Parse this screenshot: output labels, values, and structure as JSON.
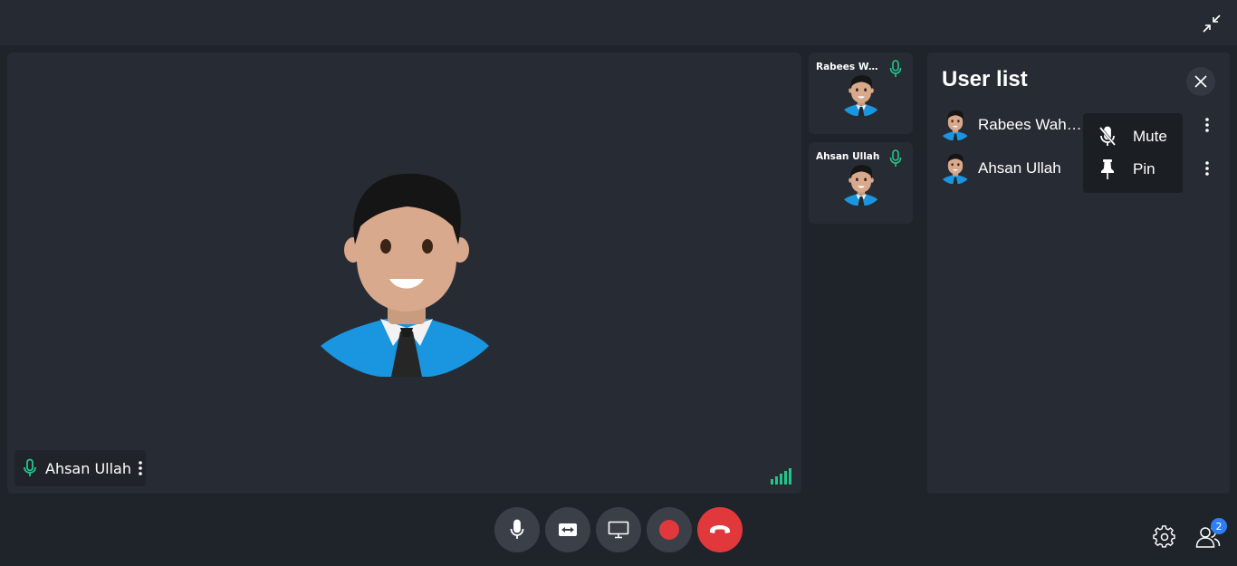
{
  "colors": {
    "accent_green": "#22c58b",
    "end_call_red": "#e0383b",
    "badge_blue": "#2d7ff2"
  },
  "main_video": {
    "participant_name": "Ahsan Ullah",
    "mic_status": "unmuted",
    "signal_strength": 5
  },
  "thumbnails": [
    {
      "name": "Rabees Waheed",
      "mic_status": "unmuted"
    },
    {
      "name": "Ahsan Ullah",
      "mic_status": "unmuted"
    }
  ],
  "user_list": {
    "title": "User list",
    "users": [
      {
        "name": "Rabees Waheed"
      },
      {
        "name": "Ahsan Ullah"
      }
    ],
    "context_menu": {
      "items": [
        {
          "label": "Mute",
          "icon": "mic-off-icon"
        },
        {
          "label": "Pin",
          "icon": "pin-icon"
        }
      ]
    }
  },
  "controls": [
    "microphone",
    "camera-switch",
    "screen-share",
    "record",
    "end-call"
  ],
  "participants_count": "2"
}
